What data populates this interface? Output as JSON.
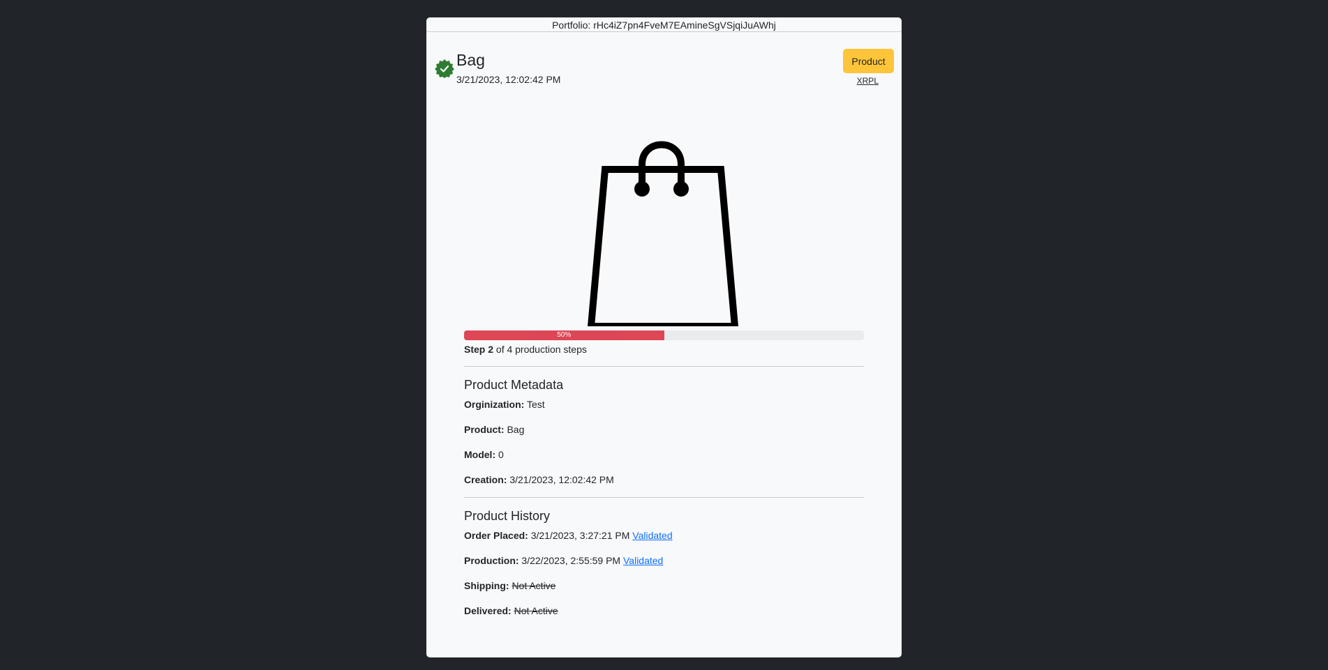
{
  "header": {
    "portfolio_label": "Portfolio: rHc4iZ7pn4FveM7EAmineSgVSjqiJuAWhj"
  },
  "item": {
    "title": "Bag",
    "date": "3/21/2023, 12:02:42 PM",
    "badge_icon": "verified-check-icon",
    "badge_color": "#2e7d32",
    "product_button_label": "Product",
    "product_button_color": "#ffc53a",
    "xrpl_link": "XRPL",
    "image_icon": "shopping-bag-icon"
  },
  "progress": {
    "percent": 50,
    "label": "50%",
    "color": "#dc3545",
    "step_bold": "Step 2",
    "step_rest": " of 4 production steps"
  },
  "metadata": {
    "heading": "Product Metadata",
    "fields": [
      {
        "label": "Orginization:",
        "value": " Test"
      },
      {
        "label": "Product:",
        "value": " Bag"
      },
      {
        "label": "Model:",
        "value": " 0"
      },
      {
        "label": "Creation:",
        "value": " 3/21/2023, 12:02:42 PM"
      }
    ]
  },
  "history": {
    "heading": "Product History",
    "events": [
      {
        "label": "Order Placed:",
        "value": " 3/21/2023, 3:27:21 PM ",
        "link": "Validated"
      },
      {
        "label": "Production:",
        "value": " 3/22/2023, 2:55:59 PM ",
        "link": "Validated"
      },
      {
        "label": "Shipping:",
        "value": " ",
        "status": "Not Active"
      },
      {
        "label": "Delivered:",
        "value": " ",
        "status": "Not Active"
      }
    ]
  }
}
